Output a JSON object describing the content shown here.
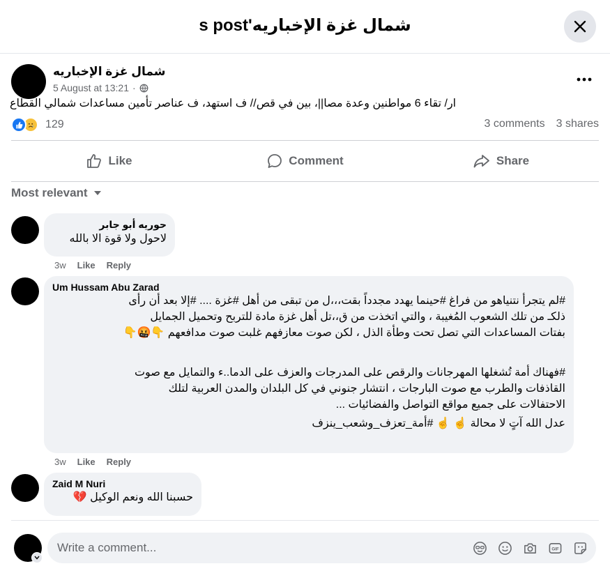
{
  "header": {
    "title": "شمال غزة الإخباريه's post",
    "close_icon": "close-icon"
  },
  "post": {
    "author": "شمال غزة الإخباريه",
    "timestamp": "5 August at 13:21",
    "audience_icon": "globe-icon",
    "more_icon": "more-icon",
    "text": "ار/ تقاء 6 مواطنين وعدة مصا||، بين في قص// ف استهد، ف عناصر تأمين مساعدات شمالي القطاع",
    "reaction_count": "129",
    "reaction_icons": [
      "like-reaction-icon",
      "sad-reaction-icon"
    ],
    "comments_count": "3 comments",
    "shares_count": "3 shares"
  },
  "actions": {
    "like_label": "Like",
    "comment_label": "Comment",
    "share_label": "Share"
  },
  "filter": {
    "label": "Most relevant"
  },
  "comments": [
    {
      "author": "حوريه أبو جابر",
      "lines": [
        "لاحول ولا قوة الا بالله"
      ],
      "time": "3w",
      "like": "Like",
      "reply": "Reply"
    },
    {
      "author": "Um Hussam Abu Zarad",
      "lines": [
        "#لم يتجرأ نتنياهو من فراغ #حينما يهدد مجدداً بقت،،،ل من تبقى من أهل #غزة .... #إلا بعد أن رأى",
        "ذلكـ من تلك الشعوب المُغيبة ، والتي اتخذت من ق،،تل أهل غزة مادة للتربح وتحميل الجمايل",
        "بفتات المساعدات التي تصل تحت وطأة الذل ، لكن صوت معازفهم غلبت صوت مدافعهم 👇🤬👇",
        "",
        "#فهناك أمة تُشغلها المهرجانات والرقص على المدرجات والعزف على الدما..ء والتمايل مع صوت",
        "القاذفات والطرب مع صوت البارجات ، انتشار جنوني في كل البلدان والمدن العربية لتلك",
        "الاحتفالات على جميع مواقع التواصل والفضائيات ...",
        "عدل الله آتٍ لا محالة ☝️ ☝️ #أمة_تعزف_وشعب_ينزف"
      ],
      "time": "3w",
      "like": "Like",
      "reply": "Reply"
    },
    {
      "author": "Zaid M Nuri",
      "lines": [
        "حسبنا الله ونعم الوكيل 💔"
      ],
      "time": "",
      "like": "",
      "reply": ""
    }
  ],
  "composer": {
    "placeholder": "Write a comment...",
    "icons": [
      "avatar-sticker-icon",
      "emoji-icon",
      "camera-icon",
      "gif-icon",
      "sticker-icon"
    ]
  },
  "colors": {
    "accent": "#1877f2",
    "muted": "#65676b",
    "bubble": "#f0f2f5"
  }
}
